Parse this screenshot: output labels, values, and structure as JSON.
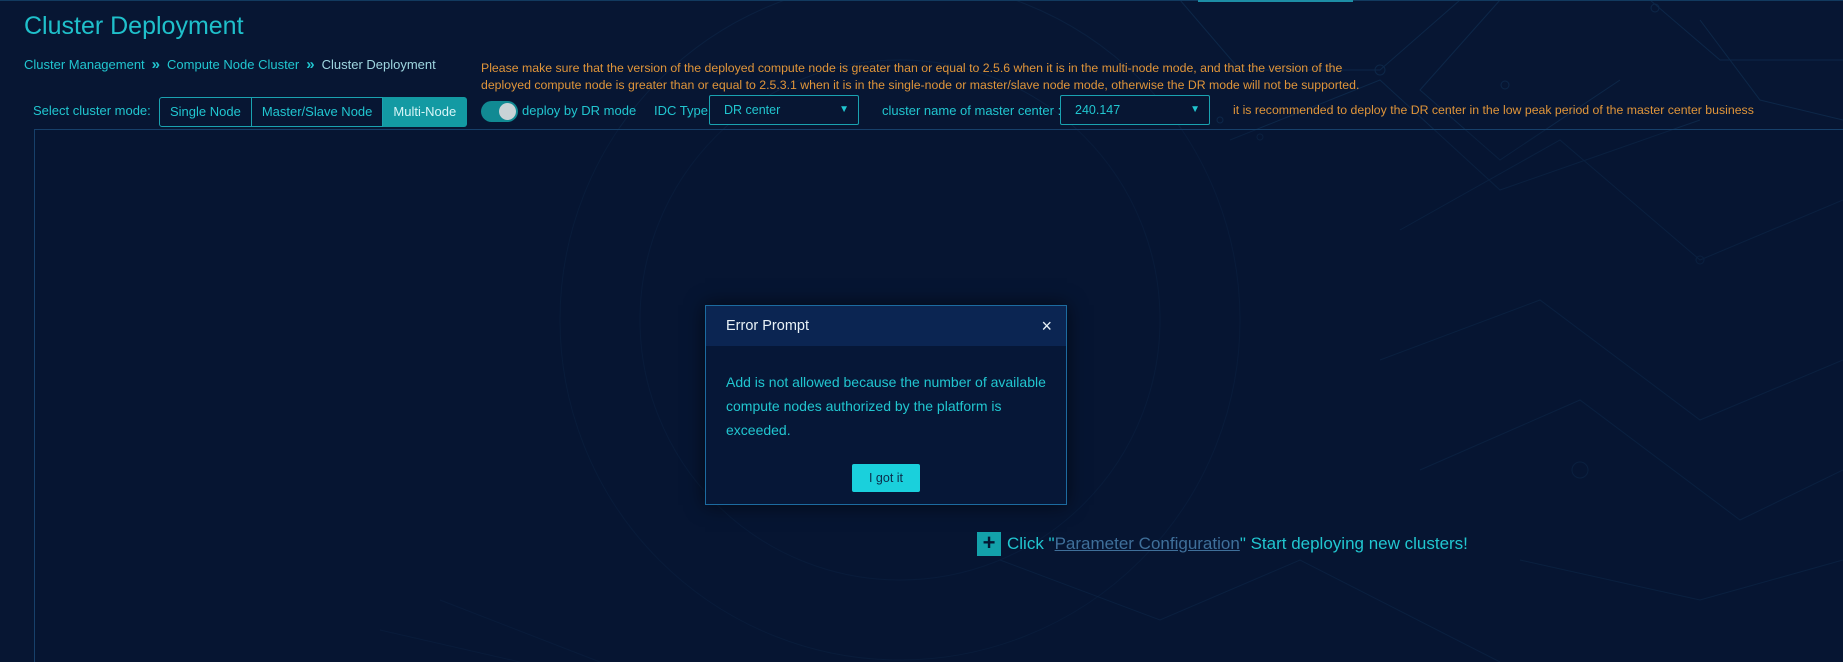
{
  "page": {
    "title": "Cluster Deployment"
  },
  "breadcrumb": {
    "items": [
      "Cluster Management",
      "Compute Node Cluster",
      "Cluster Deployment"
    ],
    "separator": "»"
  },
  "notice": {
    "line1": "Please make sure that the version of the deployed compute node is greater than or equal to 2.5.6 when it is in the multi-node mode, and that the version of the",
    "line2": "deployed compute node is greater than or equal to 2.5.3.1 when it is in the single-node or master/slave node mode, otherwise the DR mode will not be supported."
  },
  "toolbar": {
    "mode_label": "Select cluster mode:",
    "modes": [
      "Single Node",
      "Master/Slave Node",
      "Multi-Node"
    ],
    "active_mode": "Multi-Node",
    "dr_toggle_label": "deploy by DR mode",
    "dr_toggle_on": true,
    "idc_label": "IDC Type:",
    "idc_value": "DR center",
    "master_label": "cluster name of master center :",
    "master_value": "240.147",
    "caret": "▼",
    "recommendation": "it is recommended to deploy the DR center in the low peak period of the master center business"
  },
  "deploy_hint": {
    "plus": "+",
    "prefix": "Click \"",
    "link": "Parameter Configuration",
    "suffix": "\" Start deploying new clusters!"
  },
  "modal": {
    "title": "Error Prompt",
    "close": "×",
    "message": "Add is not allowed because the number of available compute nodes authorized by the platform is exceeded.",
    "button": "I got it"
  },
  "colors": {
    "background": "#071633",
    "accent": "#21c6d0",
    "warning": "#e0953a"
  }
}
